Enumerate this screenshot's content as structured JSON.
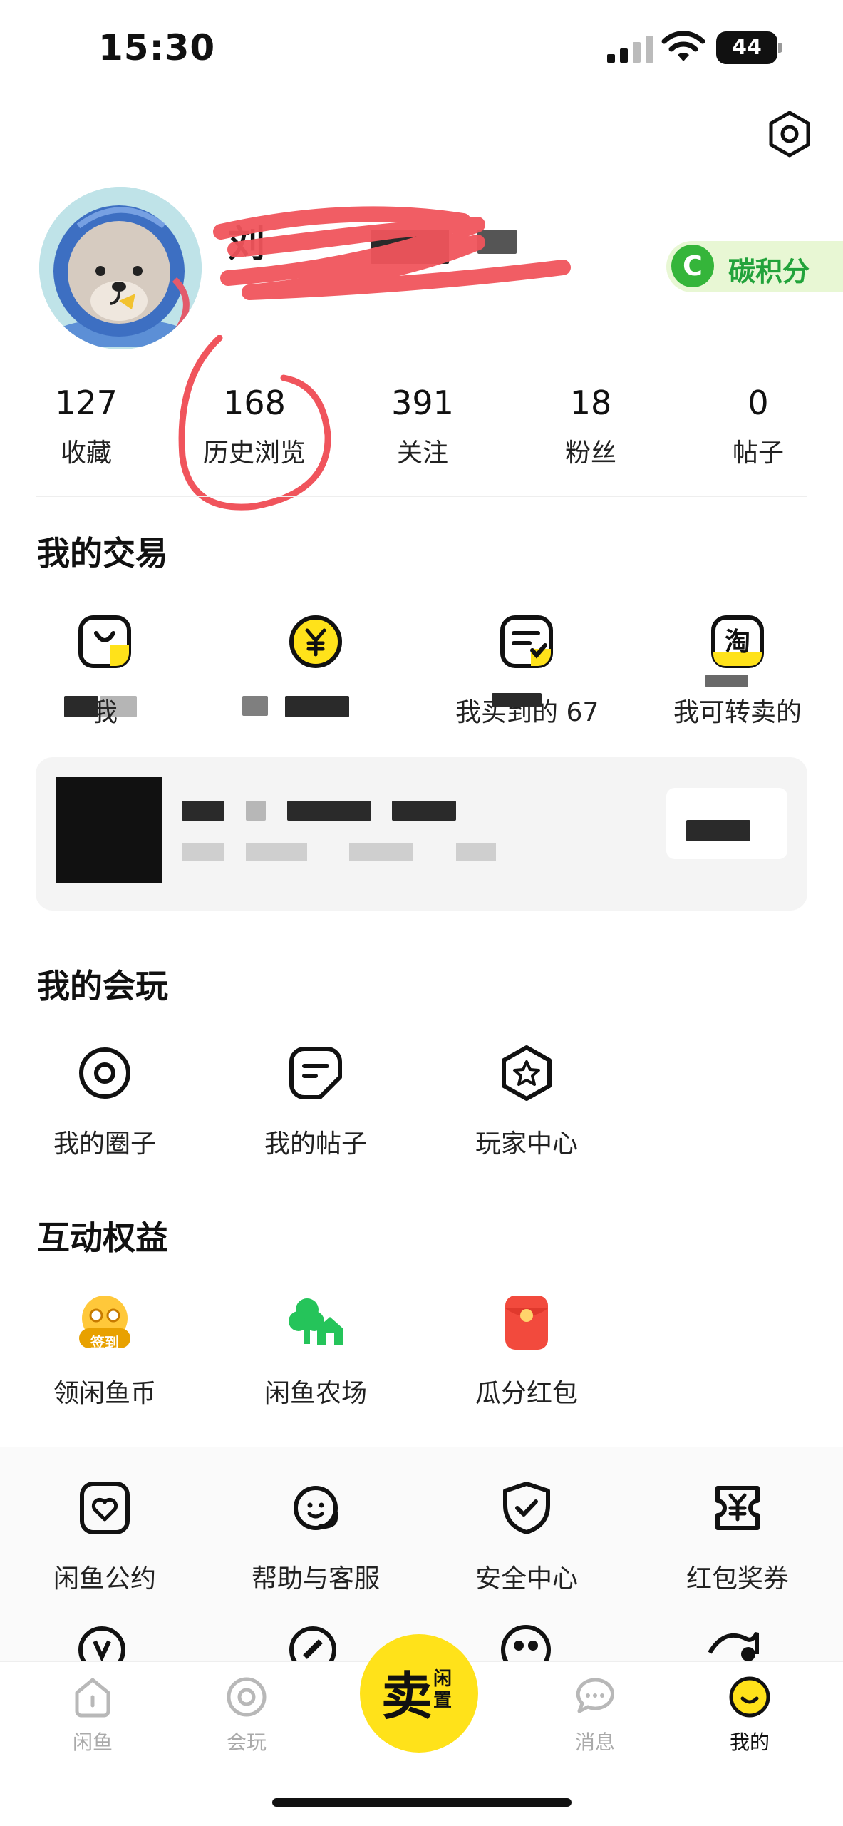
{
  "status_bar": {
    "time": "15:30",
    "battery": "44"
  },
  "profile": {
    "name_prefix": "刘",
    "carbon_badge_letter": "C",
    "carbon_badge_label": "碳积分"
  },
  "stats": [
    {
      "value": "127",
      "label": "收藏"
    },
    {
      "value": "168",
      "label": "历史浏览"
    },
    {
      "value": "391",
      "label": "关注"
    },
    {
      "value": "18",
      "label": "粉丝"
    },
    {
      "value": "0",
      "label": "帖子"
    }
  ],
  "trade": {
    "title": "我的交易",
    "items": [
      {
        "label": "我"
      },
      {
        "label": ""
      },
      {
        "label": "我买到的 67"
      },
      {
        "label": "我可转卖的"
      }
    ]
  },
  "play": {
    "title": "我的会玩",
    "items": [
      {
        "label": "我的圈子"
      },
      {
        "label": "我的帖子"
      },
      {
        "label": "玩家中心"
      }
    ]
  },
  "benefits": {
    "title": "互动权益",
    "checkin_text": "签到",
    "items": [
      {
        "label": "领闲鱼币"
      },
      {
        "label": "闲鱼农场"
      },
      {
        "label": "瓜分红包"
      }
    ]
  },
  "services": {
    "items": [
      {
        "label": "闲鱼公约"
      },
      {
        "label": "帮助与客服"
      },
      {
        "label": "安全中心"
      },
      {
        "label": "红包奖券"
      }
    ]
  },
  "tabbar": {
    "tabs": [
      {
        "label": "闲鱼"
      },
      {
        "label": "会玩"
      },
      {
        "label": "消息"
      },
      {
        "label": "我的"
      }
    ],
    "sell_main": "卖",
    "sell_sub": "闲置"
  },
  "colors": {
    "brand_yellow": "#FFE21A",
    "carbon_green": "#35B53A",
    "annotation_red": "#F0545C"
  }
}
